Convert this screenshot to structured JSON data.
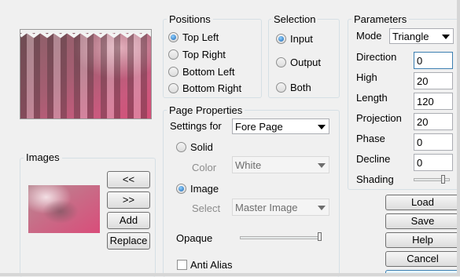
{
  "positions": {
    "title": "Positions",
    "options": [
      "Top Left",
      "Top Right",
      "Bottom Left",
      "Bottom Right"
    ],
    "selected": "Top Left"
  },
  "selection": {
    "title": "Selection",
    "options": [
      "Input",
      "Output",
      "Both"
    ],
    "selected": "Input"
  },
  "parameters": {
    "title": "Parameters",
    "mode_label": "Mode",
    "mode_value": "Triangle",
    "direction_label": "Direction",
    "direction_value": "0",
    "high_label": "High",
    "high_value": "20",
    "length_label": "Length",
    "length_value": "120",
    "projection_label": "Projection",
    "projection_value": "20",
    "phase_label": "Phase",
    "phase_value": "0",
    "decline_label": "Decline",
    "decline_value": "0",
    "shading_label": "Shading",
    "shading_level": 0.85
  },
  "page_properties": {
    "title": "Page Properties",
    "settings_for_label": "Settings for",
    "settings_for_value": "Fore Page",
    "solid_label": "Solid",
    "color_label": "Color",
    "color_value": "White",
    "image_label": "Image",
    "select_label": "Select",
    "select_value": "Master Image",
    "selected": "Image",
    "opaque_label": "Opaque",
    "opaque_level": 1.0,
    "anti_alias_label": "Anti Alias",
    "anti_alias_checked": false
  },
  "images": {
    "title": "Images",
    "prev_label": "<<",
    "next_label": ">>",
    "add_label": "Add",
    "replace_label": "Replace"
  },
  "actions": {
    "load_label": "Load",
    "save_label": "Save",
    "help_label": "Help",
    "cancel_label": "Cancel"
  },
  "colors": {
    "dialog_bg": "#f0f0f0",
    "radio_dot": "#1d66b3",
    "preview_pink": "#c8607a",
    "preview_dark": "#7a5058"
  }
}
